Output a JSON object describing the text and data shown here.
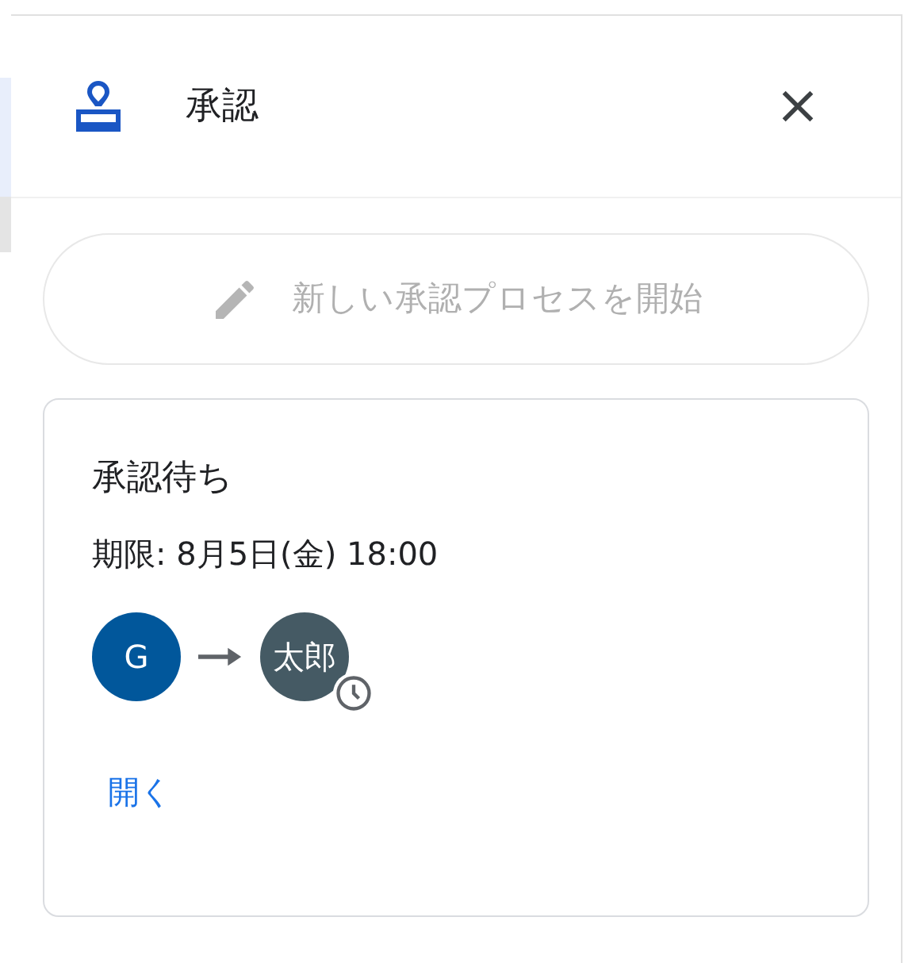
{
  "panel": {
    "title": "承認"
  },
  "start_button": {
    "label": "新しい承認プロセスを開始",
    "disabled": true
  },
  "request": {
    "status": "承認待ち",
    "deadline": "期限: 8月5日(金) 18:00",
    "approvers": [
      {
        "initials": "G",
        "color": "#01579b",
        "pending": false
      },
      {
        "initials": "太郎",
        "color": "#455a64",
        "pending": true
      }
    ],
    "open_link": "開く"
  }
}
